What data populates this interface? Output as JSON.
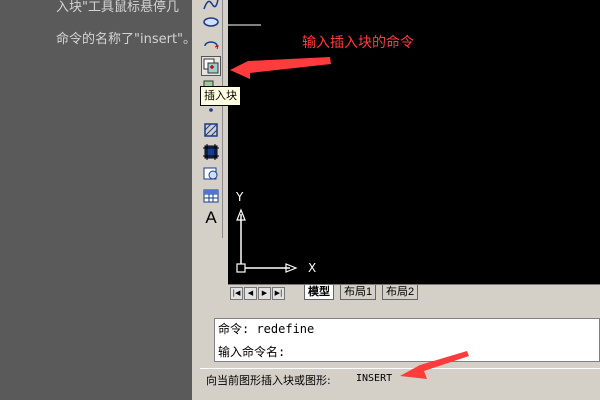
{
  "article": {
    "line1": "入块\"工具鼠标悬停几",
    "line2": "命令的名称了\"insert\"。"
  },
  "toolbar": {
    "buttons": [
      {
        "name": "spline-icon"
      },
      {
        "name": "ellipse-icon"
      },
      {
        "name": "ellipse-arc-icon"
      },
      {
        "name": "insert-block-icon"
      },
      {
        "name": "make-block-icon"
      },
      {
        "name": "point-icon"
      },
      {
        "name": "hatch-icon"
      },
      {
        "name": "region-icon"
      },
      {
        "name": "table-icon"
      },
      {
        "name": "multiline-text-icon"
      }
    ],
    "text_button_glyph": "A"
  },
  "tooltip": "插入块",
  "annotations": {
    "top": "输入插入块的命令"
  },
  "axes": {
    "y": "Y",
    "x": "X"
  },
  "tabs": {
    "nav": [
      "|◀",
      "◀",
      "▶",
      "▶|"
    ],
    "items": [
      {
        "label": "模型",
        "active": true
      },
      {
        "label": "布局1",
        "active": false
      },
      {
        "label": "布局2",
        "active": false
      }
    ]
  },
  "command": {
    "line1": "命令: redefine",
    "line2": "输入命令名:"
  },
  "status": {
    "description": "向当前图形插入块或图形:",
    "command": "INSERT"
  },
  "colors": {
    "annotation": "#ff3b3b",
    "canvas": "#000000"
  }
}
